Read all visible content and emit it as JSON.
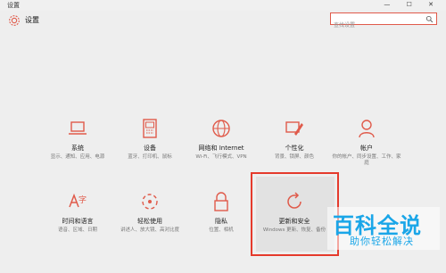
{
  "window": {
    "title": "设置",
    "controls": "— ☐ ✕"
  },
  "header": {
    "app_name": "设置"
  },
  "search": {
    "placeholder": "查找设置"
  },
  "tiles": [
    {
      "name": "系统",
      "desc": "显示、通知、应用、电源"
    },
    {
      "name": "设备",
      "desc": "蓝牙、打印机、鼠标"
    },
    {
      "name": "网络和 Internet",
      "desc": "Wi-Fi、飞行模式、VPN"
    },
    {
      "name": "个性化",
      "desc": "背景、锁屏、颜色"
    },
    {
      "name": "帐户",
      "desc": "你的帐户、同步设置、工作、家庭"
    },
    {
      "name": "时间和语言",
      "desc": "语音、区域、日期"
    },
    {
      "name": "轻松使用",
      "desc": "讲述人、放大镜、高对比度"
    },
    {
      "name": "隐私",
      "desc": "位置、相机"
    },
    {
      "name": "更新和安全",
      "desc": "Windows 更新、恢复、备份"
    }
  ],
  "watermark": {
    "title": "百科全说",
    "subtitle": "助你轻松解决"
  },
  "colors": {
    "accent": "#e05a4a",
    "highlight": "#e53a2c",
    "watermark": "#1aa6e8"
  }
}
